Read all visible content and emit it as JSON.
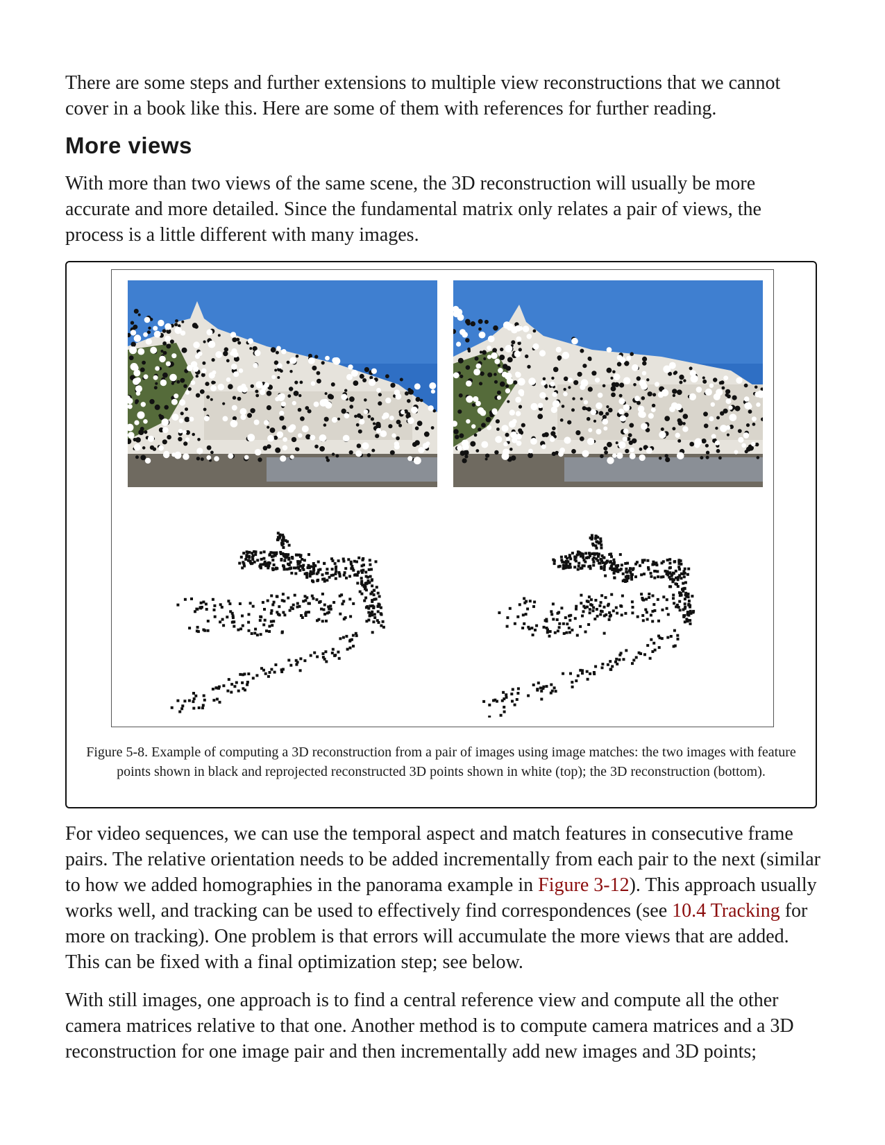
{
  "paragraphs": {
    "intro": "There are some steps and further extensions to multiple view reconstructions that we cannot cover in a book like this. Here are some of them with references for further reading.",
    "more_views": "With more than two views of the same scene, the 3D reconstruction will usually be more accurate and more detailed. Since the fundamental matrix only relates a pair of views, the process is a little different with many images.",
    "video_a": "For video sequences, we can use the temporal aspect and match features in consecutive frame pairs. The relative orientation needs to be added incrementally from each pair to the next (similar to how we added homographies in the panorama example in ",
    "video_link1": "Figure 3-12",
    "video_b": "). This approach usually works well, and tracking can be used to effectively find correspondences (see ",
    "video_link2": "10.4 Tracking",
    "video_c": " for more on tracking). One problem is that errors will accumulate the more views that are added. This can be fixed with a final optimization step; see below.",
    "still": "With still images, one approach is to find a central reference view and compute all the other camera matrices relative to that one. Another method is to compute camera matrices and a 3D reconstruction for one image pair and then incrementally add new images and 3D points;"
  },
  "heading": "More views",
  "figure": {
    "caption": "Figure 5-8. Example of computing a 3D reconstruction from a pair of images using image matches: the two images with feature points shown in black and reprojected reconstructed 3D points shown in white (top); the 3D reconstruction (bottom).",
    "sky_color": "#2f6fc4",
    "building_color": "#e6e3dc",
    "point_color": "#111111"
  }
}
